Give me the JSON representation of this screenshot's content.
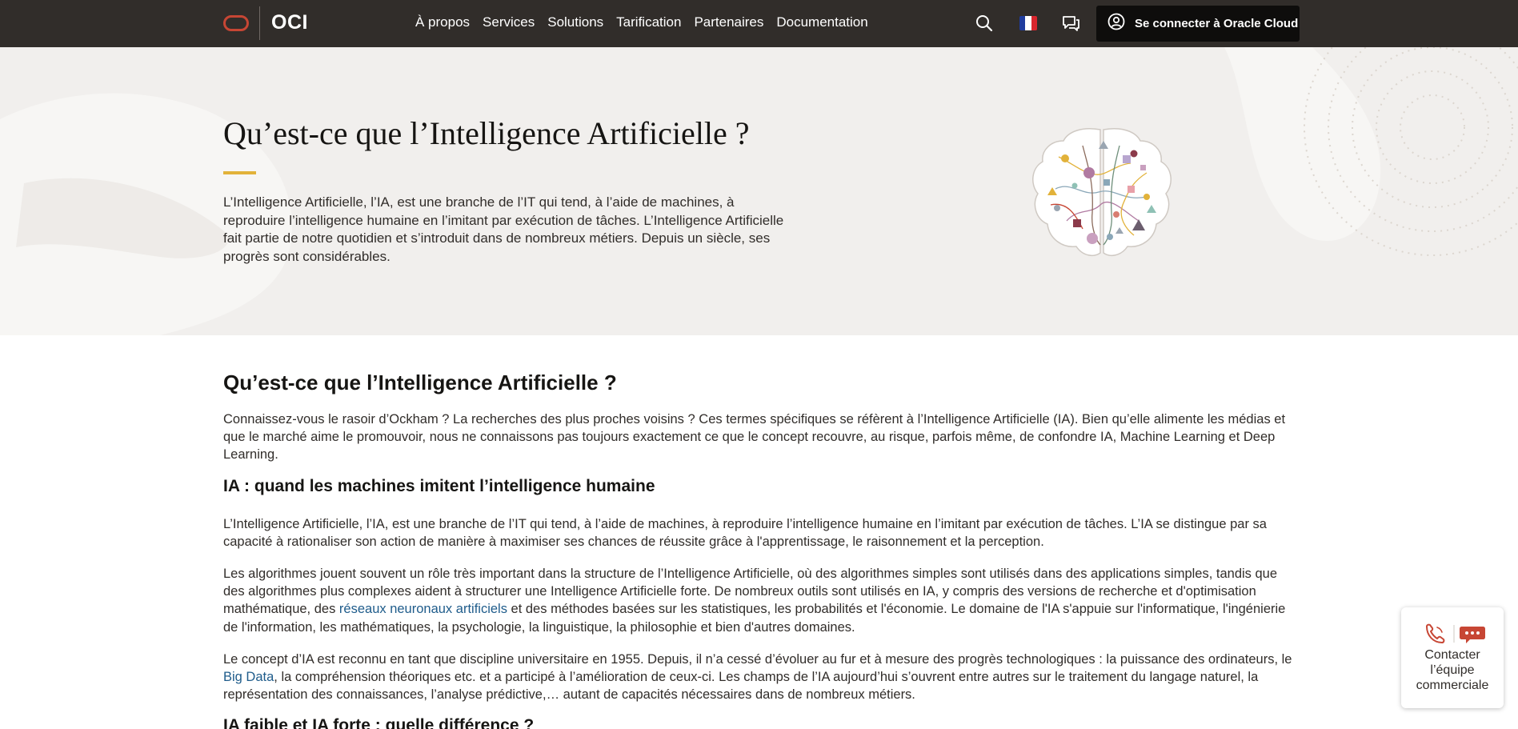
{
  "header": {
    "brand": "OCI",
    "nav": [
      "À propos",
      "Services",
      "Solutions",
      "Tarification",
      "Partenaires",
      "Documentation"
    ],
    "signin_label": "Se connecter à Oracle Cloud",
    "icons": [
      "search-icon",
      "flag-france-icon",
      "chat-icon",
      "user-icon"
    ]
  },
  "hero": {
    "title": "Qu’est-ce que l’Intelligence Artificielle ?",
    "description": "L’Intelligence Artificielle, l’IA, est une branche de l’IT qui tend, à l’aide de machines, à reproduire l’intelligence humaine en l’imitant par exécution de tâches. L’Intelligence Artificielle fait partie de notre quotidien et s’introduit dans de nombreux métiers. Depuis un siècle, ses progrès sont considérables.",
    "illustration": "ai-brain-illustration"
  },
  "article": {
    "h2": "Qu’est-ce que l’Intelligence Artificielle ?",
    "intro": "Connaissez-vous le rasoir d’Ockham ? La recherches des plus proches voisins ? Ces termes spécifiques se réfèrent à l’Intelligence Artificielle (IA). Bien qu’elle alimente les médias et que le marché aime le promouvoir, nous ne connaissons pas toujours exactement ce que le concept recouvre, au risque, parfois même, de confondre IA, Machine Learning et Deep Learning.",
    "h3_1": "IA : quand les machines imitent l’intelligence humaine",
    "p1": "L’Intelligence Artificielle, l’IA, est une branche de l’IT qui tend, à l’aide de machines, à reproduire l’intelligence humaine en l’imitant par exécution de tâches. L’IA se distingue par sa capacité à rationaliser son action de manière à maximiser ses chances de réussite grâce à l'apprentissage, le raisonnement et la perception.",
    "p2_start": "Les algorithmes jouent souvent un rôle très important dans la structure de l’Intelligence Artificielle, où des algorithmes simples sont utilisés dans des applications simples, tandis que des algorithmes plus complexes aident à structurer une Intelligence Artificielle forte. De nombreux outils sont utilisés en IA, y compris des versions de recherche et d'optimisation mathématique, des ",
    "p2_link": "réseaux neuronaux artificiels",
    "p2_end": " et des méthodes basées sur les statistiques, les probabilités et l'économie. Le domaine de l'IA s'appuie sur l'informatique, l'ingénierie de l'information, les mathématiques, la psychologie, la linguistique, la philosophie et bien d'autres domaines.",
    "p3_start": "Le concept d’IA est reconnu en tant que discipline universitaire en 1955. Depuis, il n’a cessé d’évoluer au fur et à mesure des progrès technologiques : la puissance des ordinateurs, le ",
    "p3_link": "Big Data",
    "p3_end": ", la compréhension théoriques etc. et a participé à l’amélioration de ceux-ci. Les champs de l’IA aujourd’hui s’ouvrent entre autres sur le traitement du langage naturel, la représentation des connaissances, l’analyse prédictive,… autant de capacités nécessaires dans de nombreux métiers.",
    "h3_2": "IA faible et IA forte : quelle différence ?"
  },
  "contact_widget": {
    "line1": "Contacter",
    "line2": "l’équipe",
    "line3": "commerciale",
    "icons": [
      "phone-icon",
      "chat-bubble-icon"
    ]
  },
  "colors": {
    "header_bg": "#312d2a",
    "hero_bg": "#f1efed",
    "accent_rule": "#e2b23a",
    "link": "#1f5c8b",
    "oracle_red": "#c74634"
  }
}
